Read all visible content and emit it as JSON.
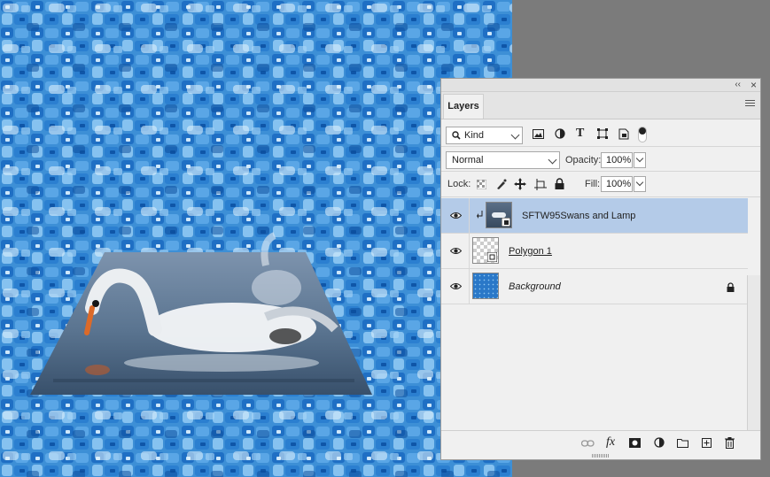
{
  "panel": {
    "collapse_glyph": "‹‹",
    "close_glyph": "×",
    "tab_label": "Layers",
    "menu_icon": "panel-menu-icon"
  },
  "filter": {
    "kind_label": "Kind",
    "icons": [
      "image-filter-icon",
      "adjustment-filter-icon",
      "type-filter-icon",
      "shape-filter-icon",
      "smart-object-filter-icon",
      "filter-toggle-icon"
    ]
  },
  "blend": {
    "mode": "Normal",
    "opacity_label": "Opacity:",
    "opacity_value": "100%"
  },
  "lock": {
    "label": "Lock:",
    "icons": [
      "lock-transparent-icon",
      "lock-image-icon",
      "lock-position-icon",
      "lock-artboard-icon",
      "lock-all-icon"
    ],
    "fill_label": "Fill:",
    "fill_value": "100%"
  },
  "layers": [
    {
      "name": "SFTW95Swans and Lamp",
      "selected": true,
      "clipped": true,
      "thumb": "swan-photo"
    },
    {
      "name": "Polygon 1",
      "selected": false,
      "underline": true,
      "thumb": "transparent-shape"
    },
    {
      "name": "Background",
      "selected": false,
      "italic": true,
      "locked": true,
      "thumb": "pool-tiles"
    }
  ],
  "bottom_icons": [
    "link-layers-icon",
    "fx-icon",
    "layer-mask-icon",
    "adjustment-layer-icon",
    "group-folder-icon",
    "new-layer-icon",
    "trash-icon"
  ],
  "fx_label": "fx",
  "colors": {
    "selected_row": "#b4cbe8",
    "panel_bg": "#f0f0f0",
    "workspace_gray": "#7b7b7b",
    "pool_blue": "#2a78c8"
  }
}
